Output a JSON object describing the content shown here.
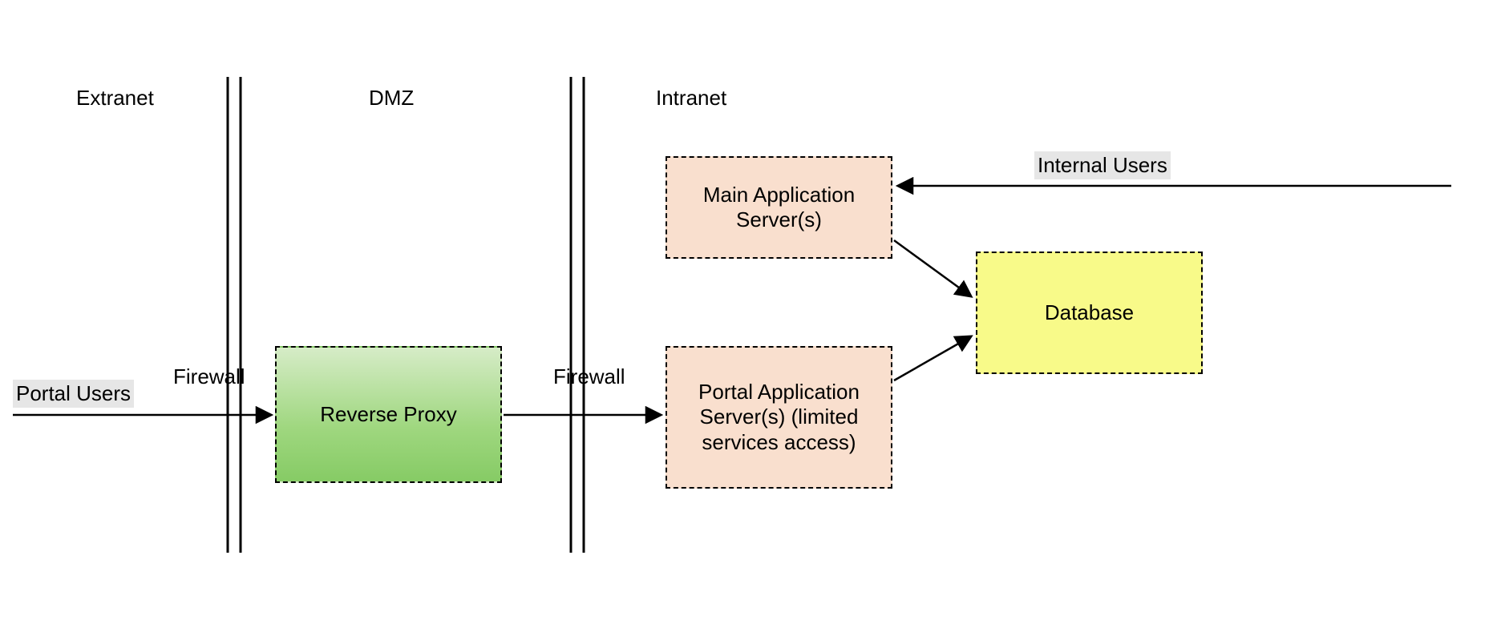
{
  "zones": {
    "extranet": "Extranet",
    "dmz": "DMZ",
    "intranet": "Intranet"
  },
  "firewall": {
    "left_label": "Firewall",
    "right_label": "Firewall"
  },
  "users": {
    "portal": "Portal Users",
    "internal": "Internal Users"
  },
  "boxes": {
    "reverse_proxy": "Reverse Proxy",
    "main_app": "Main Application\nServer(s)",
    "portal_app": "Portal Application\nServer(s)\n(limited services\naccess)",
    "database": "Database"
  },
  "colors": {
    "green_from": "#d6ecc7",
    "green_to": "#86cb65",
    "peach": "#f9dfce",
    "yellow": "#f8fa89",
    "grey": "#e6e6e6"
  }
}
